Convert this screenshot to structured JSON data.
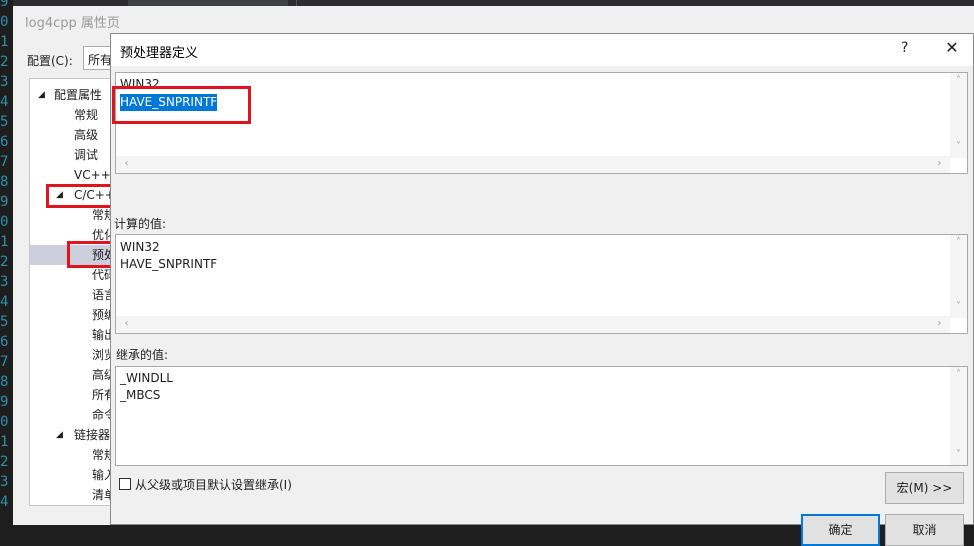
{
  "gutter": {
    "line_digits": [
      "9",
      "0",
      "1",
      "2",
      "3",
      "4",
      "5",
      "6",
      "7",
      "8",
      "9",
      "0",
      "1",
      "2",
      "3",
      "4",
      "5",
      "6",
      "7",
      "8",
      "9",
      "0",
      "1",
      "2",
      "3",
      "4"
    ]
  },
  "property_page": {
    "title": "log4cpp 属性页",
    "config_label": "配置(C):",
    "config_value": "所有",
    "tree": [
      {
        "label": "配置属性",
        "expanded": true
      },
      {
        "label": "常规"
      },
      {
        "label": "高级"
      },
      {
        "label": "调试"
      },
      {
        "label": "VC++"
      },
      {
        "label": "C/C++",
        "expanded": true
      },
      {
        "label": "常规"
      },
      {
        "label": "优化"
      },
      {
        "label": "预处",
        "selected": true
      },
      {
        "label": "代码"
      },
      {
        "label": "语言"
      },
      {
        "label": "预编"
      },
      {
        "label": "输出"
      },
      {
        "label": "浏览"
      },
      {
        "label": "高级"
      },
      {
        "label": "所有"
      },
      {
        "label": "命令"
      },
      {
        "label": "链接器",
        "expanded": true
      },
      {
        "label": "常规"
      },
      {
        "label": "输入"
      },
      {
        "label": "清单"
      }
    ]
  },
  "dialog": {
    "title": "预处理器定义",
    "help_label": "?",
    "close_label": "✕",
    "edit_lines": [
      "WIN32",
      "HAVE_SNPRINTF"
    ],
    "evaluated_label": "计算的值:",
    "evaluated_lines": [
      "WIN32",
      "HAVE_SNPRINTF"
    ],
    "inherited_label": "继承的值:",
    "inherited_lines": [
      "_WINDLL",
      "_MBCS"
    ],
    "inherit_checkbox_label": "从父级或项目默认设置继承(I)",
    "inherit_checked": false,
    "macro_button": "宏(M) >>",
    "ok_button": "确定",
    "cancel_button": "取消"
  },
  "colors": {
    "selection": "#0078d7",
    "annotation_red": "#e0141e",
    "tree_selection": "#cdd0dc"
  }
}
